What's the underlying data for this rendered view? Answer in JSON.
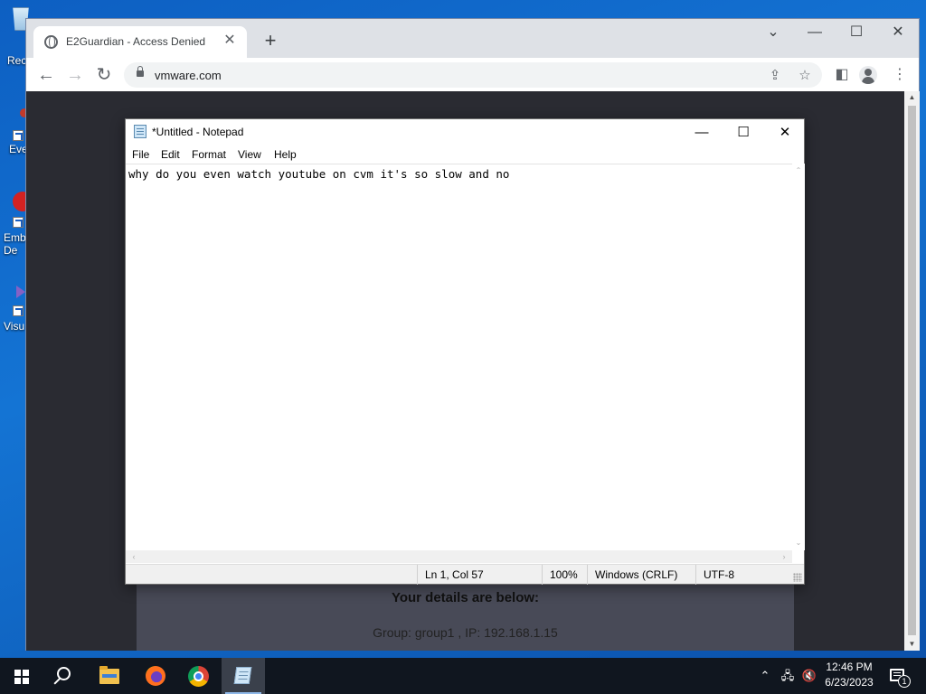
{
  "desktop": {
    "icons": [
      {
        "label": "Rec",
        "icon": "recycle-bin-icon"
      },
      {
        "label": "Eve",
        "icon": "event-icon"
      },
      {
        "label": "Emb\nDe",
        "icon": "embarcadero-icon"
      },
      {
        "label": "Visu",
        "icon": "visual-studio-icon"
      }
    ]
  },
  "browser": {
    "tab_title": "E2Guardian - Access Denied",
    "url": "vmware.com",
    "page": {
      "heading": "Your details are below:",
      "detail": "Group: group1 , IP: 192.168.1.15"
    }
  },
  "notepad": {
    "title": "*Untitled - Notepad",
    "menu": [
      "File",
      "Edit",
      "Format",
      "View",
      "Help"
    ],
    "content": "why do you even watch youtube on cvm it's so slow and no",
    "status": {
      "position": "Ln 1, Col 57",
      "zoom": "100%",
      "line_ending": "Windows (CRLF)",
      "encoding": "UTF-8"
    }
  },
  "taskbar": {
    "apps": [
      "start-icon",
      "search-icon",
      "file-explorer-icon",
      "firefox-icon",
      "chrome-icon",
      "notepad-icon"
    ],
    "clock": {
      "time": "12:46 PM",
      "date": "6/23/2023"
    },
    "notification_count": "1"
  },
  "colors": {
    "desktop": "#1474d4",
    "browser_chrome": "#dee1e6",
    "page_bg": "#2a2b32",
    "taskbar": "#10161f"
  }
}
